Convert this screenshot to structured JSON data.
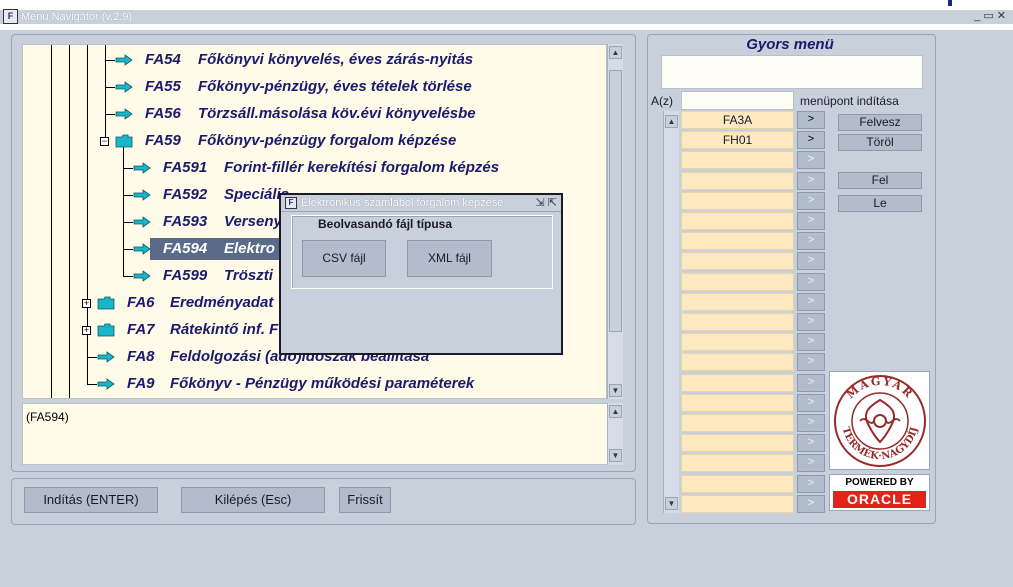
{
  "window": {
    "title": "Menü Navigátor (v.2.9)",
    "app_icon": "oracle-forms-icon",
    "controls": [
      "minimize-icon",
      "restore-icon",
      "close-icon"
    ]
  },
  "tree": {
    "nodes": [
      {
        "code": "FA54",
        "label": "Főkönyvi könyvelés, éves zárás-nyitás",
        "icon": "arrow-icon"
      },
      {
        "code": "FA55",
        "label": "Főkönyv-pénzügy, éves tételek törlése",
        "icon": "arrow-icon"
      },
      {
        "code": "FA56",
        "label": "Törzsáll.másolása köv.évi könyvelésbe",
        "icon": "arrow-icon"
      },
      {
        "code": "FA59",
        "label": "Főkönyv-pénzügy forgalom képzése",
        "icon": "folder-icon"
      },
      {
        "code": "FA591",
        "label": "Forint-fillér kerekítési forgalom képzés",
        "icon": "arrow-icon"
      },
      {
        "code": "FA592",
        "label": "Speciális",
        "icon": "arrow-icon"
      },
      {
        "code": "FA593",
        "label": "Verseny",
        "icon": "arrow-icon"
      },
      {
        "code": "FA594",
        "label": "Elektro",
        "icon": "arrow-icon",
        "selected": true
      },
      {
        "code": "FA599",
        "label": "Tröszti",
        "icon": "arrow-icon"
      },
      {
        "code": "FA6",
        "label": "Eredményadat",
        "icon": "folder-icon"
      },
      {
        "code": "FA7",
        "label": "Rátekintő inf. F",
        "icon": "folder-icon"
      },
      {
        "code": "FA8",
        "label": "Feldolgozási (adó)időszak beállítása",
        "icon": "arrow-icon"
      },
      {
        "code": "FA9",
        "label": "Főkönyv - Pénzügy működési paraméterek",
        "icon": "arrow-icon"
      }
    ]
  },
  "description": "(FA594)",
  "buttons": {
    "start": "Indítás (ENTER)",
    "exit": "Kilépés (Esc)",
    "refresh": "Frissít"
  },
  "quick_menu": {
    "title": "Gyors menü",
    "az_label": "A(z)",
    "run_label": "menüpont indítása",
    "go_label": ">",
    "entries": [
      "FA3A",
      "FH01",
      "",
      "",
      "",
      "",
      "",
      "",
      "",
      "",
      "",
      "",
      "",
      "",
      "",
      "",
      "",
      "",
      "",
      ""
    ],
    "actions": {
      "add": "Felvesz",
      "delete": "Töröl",
      "up": "Fel",
      "down": "Le"
    },
    "badge": {
      "top": "MAGYAR",
      "bottom": "TERMÉK·NAGYDÍJ"
    },
    "oracle": {
      "powered": "POWERED BY",
      "brand": "ORACLE"
    }
  },
  "dialog": {
    "title": "Elektronikus számlából forgalom képzése",
    "group_label": "Beolvasandó fájl típusa",
    "csv": "CSV fájl",
    "xml": "XML fájl"
  },
  "colors": {
    "background": "#c8d0dc",
    "tree_bg": "#fffbe8",
    "tree_text": "#1a1a6e",
    "selection": "#5a6b8a",
    "entry_bg": "#fde8c0",
    "oracle_red": "#e2231a"
  }
}
